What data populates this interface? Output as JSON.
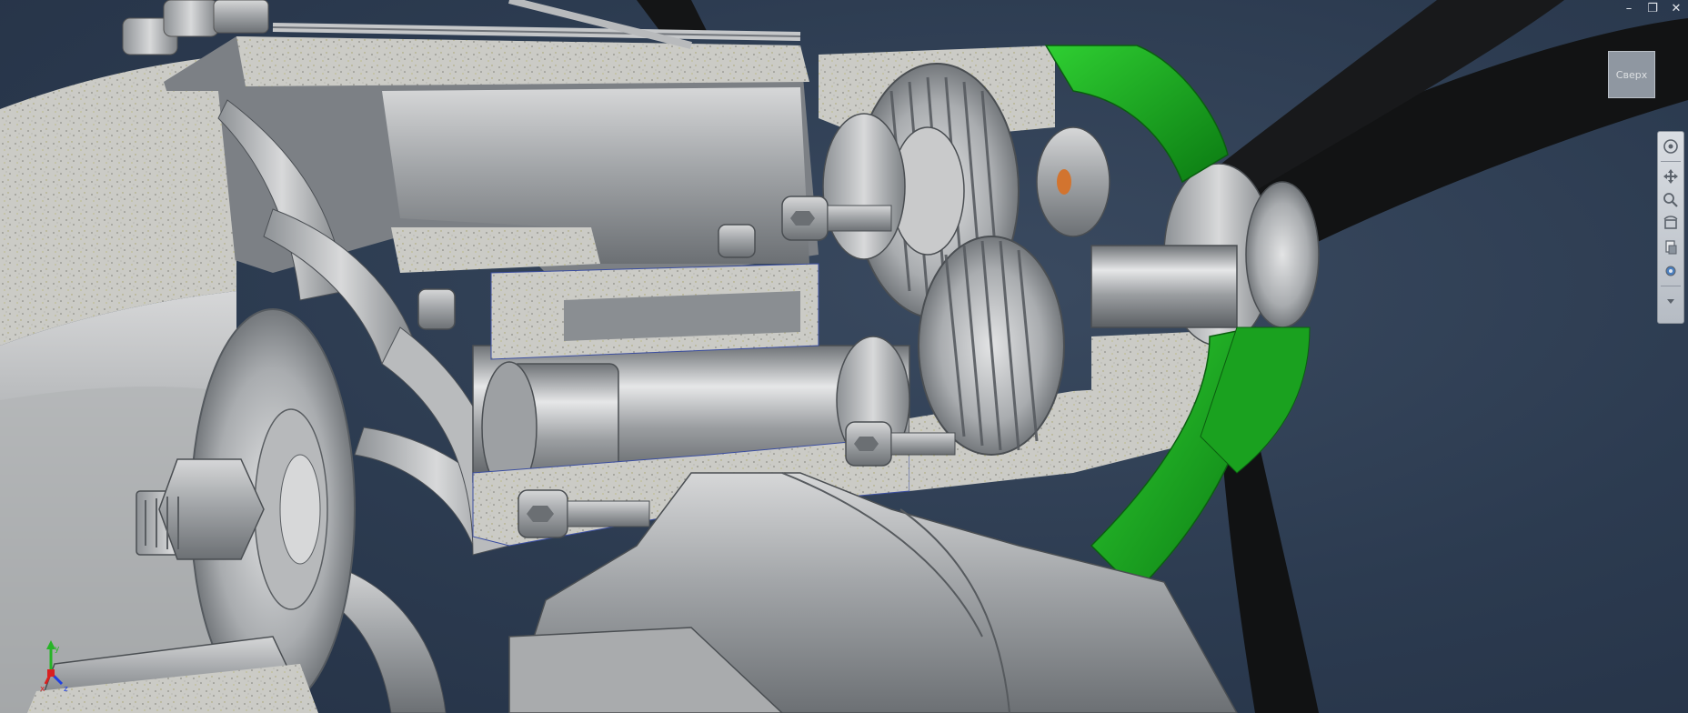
{
  "window": {
    "controls": [
      "–",
      "❐",
      "✕"
    ]
  },
  "viewcube": {
    "face_label": "Сверх"
  },
  "navbar": {
    "tools": [
      "full-navigation-wheel-icon",
      "pan-icon",
      "zoom-icon",
      "orbit-icon",
      "showmotion-icon"
    ]
  },
  "ucs": {
    "axes": [
      "x",
      "y",
      "z"
    ],
    "colors": {
      "x": "#d92020",
      "y": "#27b427",
      "z": "#2040e0"
    }
  },
  "scene": {
    "background": "#2c3b50",
    "metal": "#9ea2a6",
    "section_fill": "#c9c9c4",
    "green_part": "#16a01c",
    "propeller": "#121314"
  }
}
